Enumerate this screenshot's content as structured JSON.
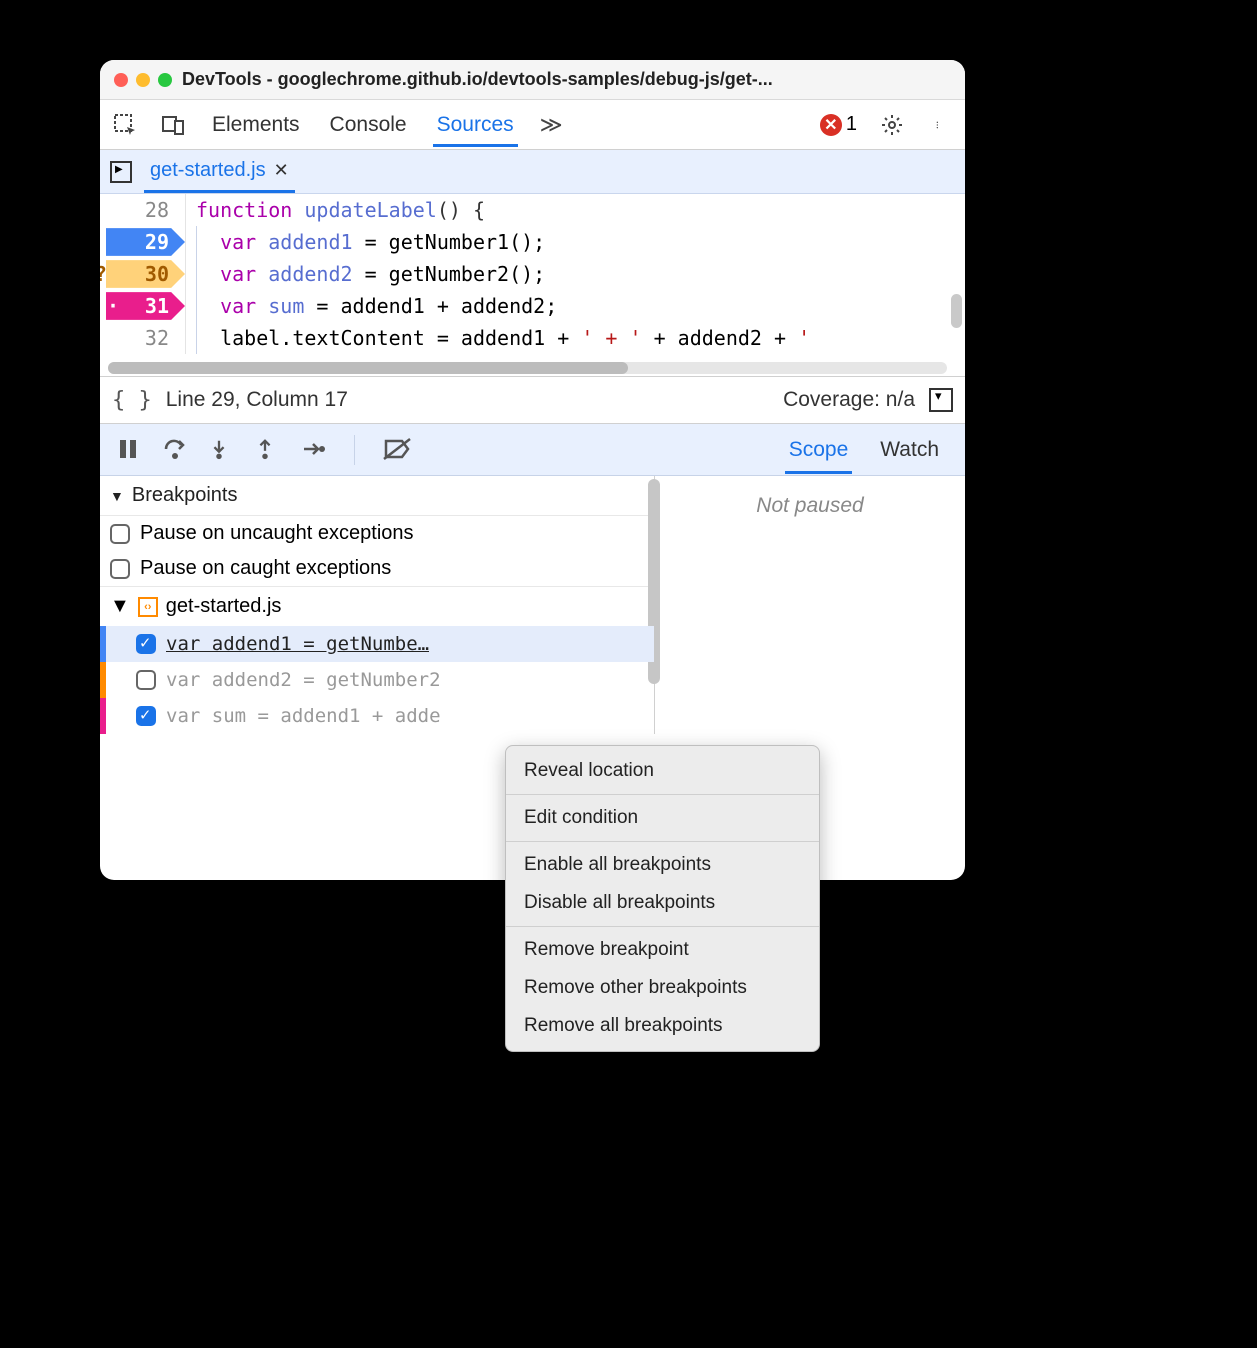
{
  "window": {
    "title": "DevTools - googlechrome.github.io/devtools-samples/debug-js/get-..."
  },
  "mainTabs": {
    "elements": "Elements",
    "console": "Console",
    "sources": "Sources",
    "errorCount": "1"
  },
  "fileTab": {
    "name": "get-started.js"
  },
  "code": {
    "lines": [
      {
        "num": "28",
        "text_html": "function updateLabel() {"
      },
      {
        "num": "29",
        "text_html": "  var addend1 = getNumber1();"
      },
      {
        "num": "30",
        "text_html": "  var addend2 = getNumber2();"
      },
      {
        "num": "31",
        "text_html": "  var sum = addend1 + addend2;"
      },
      {
        "num": "32",
        "text_html": "  label.textContent = addend1 + ' + ' + addend2 + '"
      }
    ],
    "bp29_marker": "",
    "bp30_marker": "?",
    "bp31_marker": "··"
  },
  "status": {
    "position": "Line 29, Column 17",
    "coverage": "Coverage: n/a"
  },
  "rightTabs": {
    "scope": "Scope",
    "watch": "Watch"
  },
  "rightPane": {
    "notPaused": "Not paused"
  },
  "breakpoints": {
    "header": "Breakpoints",
    "uncaught": "Pause on uncaught exceptions",
    "caught": "Pause on caught exceptions",
    "fileName": "get-started.js",
    "items": [
      {
        "text": "var addend1 = getNumbe…",
        "checked": true,
        "color": "blue"
      },
      {
        "text": "var addend2 = getNumber2",
        "checked": false,
        "color": "orange"
      },
      {
        "text": "var sum = addend1 + adde",
        "checked": true,
        "color": "pink"
      }
    ]
  },
  "contextMenu": {
    "reveal": "Reveal location",
    "edit": "Edit condition",
    "enableAll": "Enable all breakpoints",
    "disableAll": "Disable all breakpoints",
    "remove": "Remove breakpoint",
    "removeOther": "Remove other breakpoints",
    "removeAll": "Remove all breakpoints"
  }
}
